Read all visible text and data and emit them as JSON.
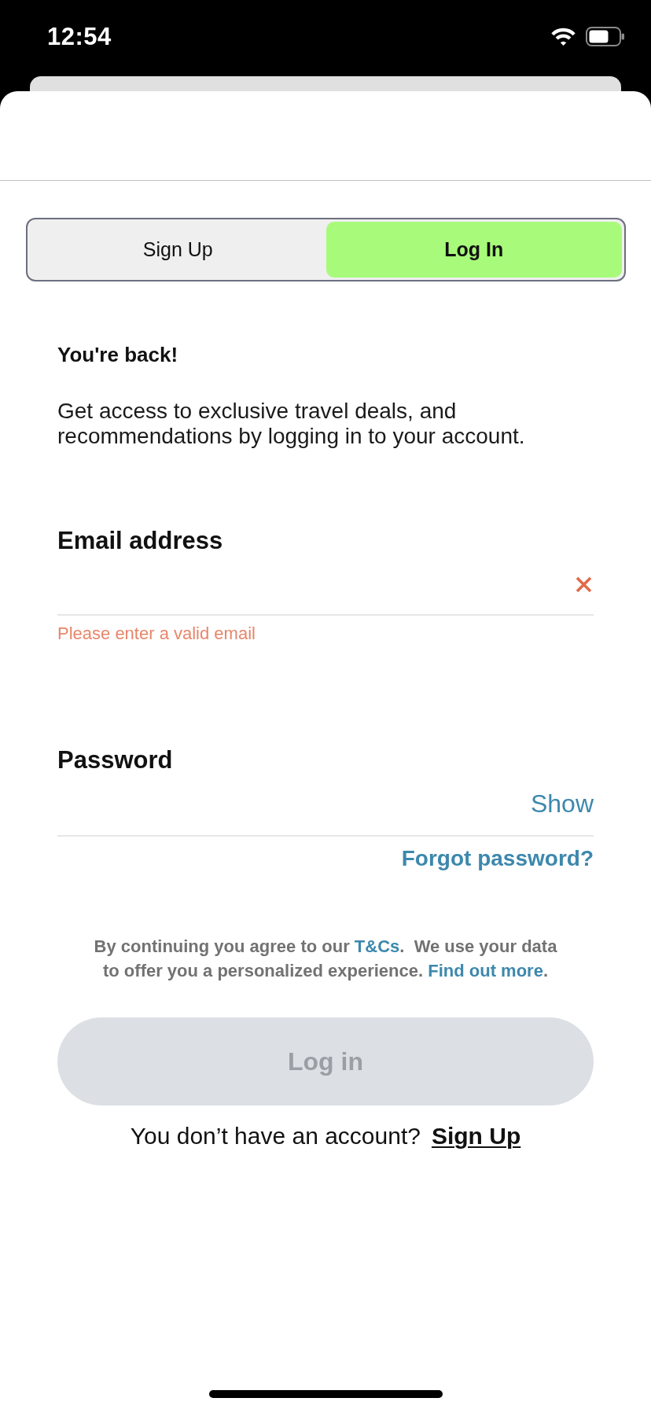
{
  "status_bar": {
    "time": "12:54"
  },
  "tabs": [
    {
      "label": "Sign Up",
      "selected": false
    },
    {
      "label": "Log In",
      "selected": true
    }
  ],
  "heading": "You're back!",
  "intro": "Get access to exclusive travel deals, and recommendations by logging in to your account.",
  "fields": [
    {
      "kind": "email",
      "label": "Email address",
      "invalid": true,
      "error": "Please enter a valid email"
    },
    {
      "kind": "password",
      "label": "Password",
      "toggle": "Show"
    }
  ],
  "forgot_password_link": "Forgot password?",
  "terms": [
    {
      "kind": "text",
      "text": "By continuing you agree to our "
    },
    {
      "kind": "link",
      "text": "T&Cs"
    },
    {
      "kind": "text",
      "text": ".  We use your data to offer you a personalized experience. "
    },
    {
      "kind": "link",
      "text": "Find out more"
    },
    {
      "kind": "text",
      "text": "."
    }
  ],
  "login_button": {
    "label": "Log in",
    "disabled": true
  },
  "signup_prompt": {
    "text": "You don’t have an account?",
    "link": "Sign Up"
  }
}
